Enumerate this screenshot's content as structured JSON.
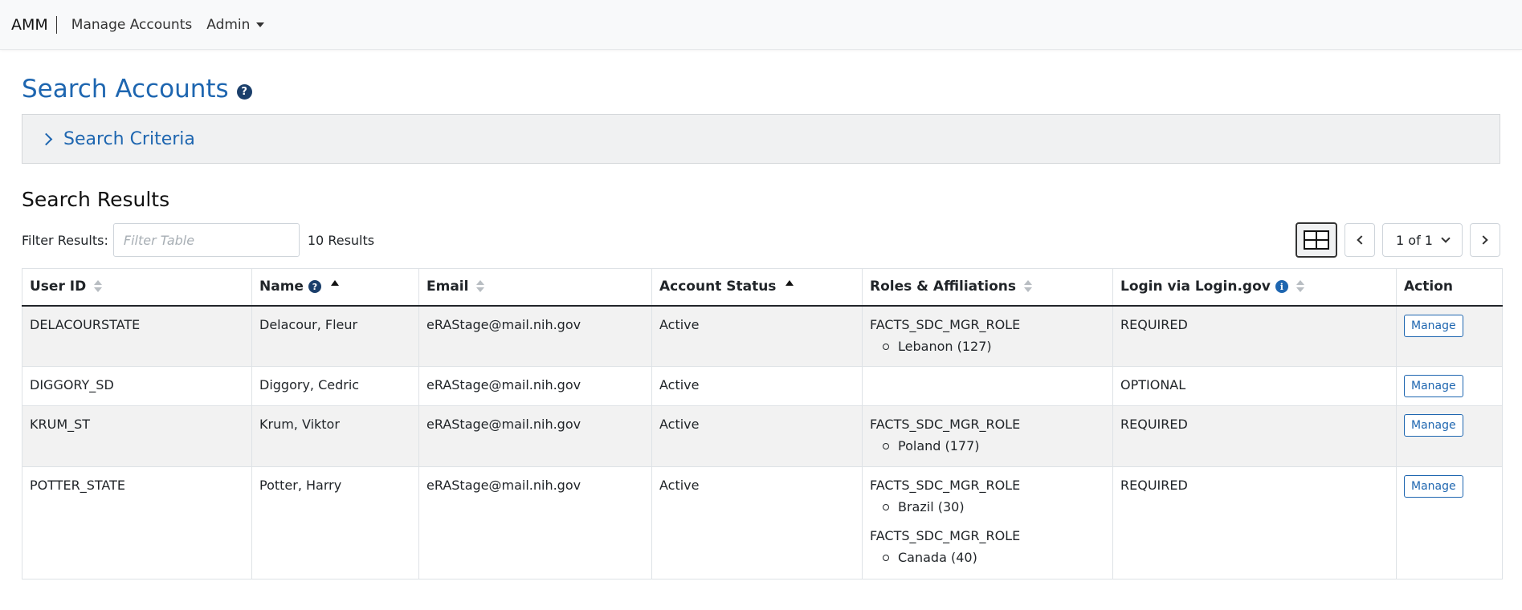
{
  "navbar": {
    "brand": "AMM",
    "manage_accounts": "Manage Accounts",
    "admin": "Admin"
  },
  "page": {
    "title": "Search Accounts",
    "help_icon": "question-circle-icon"
  },
  "criteria": {
    "label": "Search Criteria",
    "icon": "chevron-right-icon"
  },
  "results": {
    "title": "Search Results",
    "filter_label": "Filter Results:",
    "filter_placeholder": "Filter Table",
    "filter_value": "",
    "count": "10 Results",
    "pagination": "1 of 1"
  },
  "table": {
    "headers": {
      "user_id": "User ID",
      "name": "Name",
      "email": "Email",
      "status": "Account Status",
      "roles": "Roles & Affiliations",
      "login": "Login via Login.gov",
      "action": "Action"
    },
    "rows": [
      {
        "user_id": "DELACOURSTATE",
        "name": "Delacour, Fleur",
        "email": "eRAStage@mail.nih.gov",
        "status": "Active",
        "roles": [
          {
            "role": "FACTS_SDC_MGR_ROLE",
            "affiliation": "Lebanon (127)"
          }
        ],
        "login": "REQUIRED",
        "action": "Manage"
      },
      {
        "user_id": "DIGGORY_SD",
        "name": "Diggory, Cedric",
        "email": "eRAStage@mail.nih.gov",
        "status": "Active",
        "roles": [],
        "login": "OPTIONAL",
        "action": "Manage"
      },
      {
        "user_id": "KRUM_ST",
        "name": "Krum, Viktor",
        "email": "eRAStage@mail.nih.gov",
        "status": "Active",
        "roles": [
          {
            "role": "FACTS_SDC_MGR_ROLE",
            "affiliation": "Poland (177)"
          }
        ],
        "login": "REQUIRED",
        "action": "Manage"
      },
      {
        "user_id": "POTTER_STATE",
        "name": "Potter, Harry",
        "email": "eRAStage@mail.nih.gov",
        "status": "Active",
        "roles": [
          {
            "role": "FACTS_SDC_MGR_ROLE",
            "affiliation": "Brazil (30)"
          },
          {
            "role": "FACTS_SDC_MGR_ROLE",
            "affiliation": "Canada (40)"
          }
        ],
        "login": "REQUIRED",
        "action": "Manage"
      }
    ]
  }
}
